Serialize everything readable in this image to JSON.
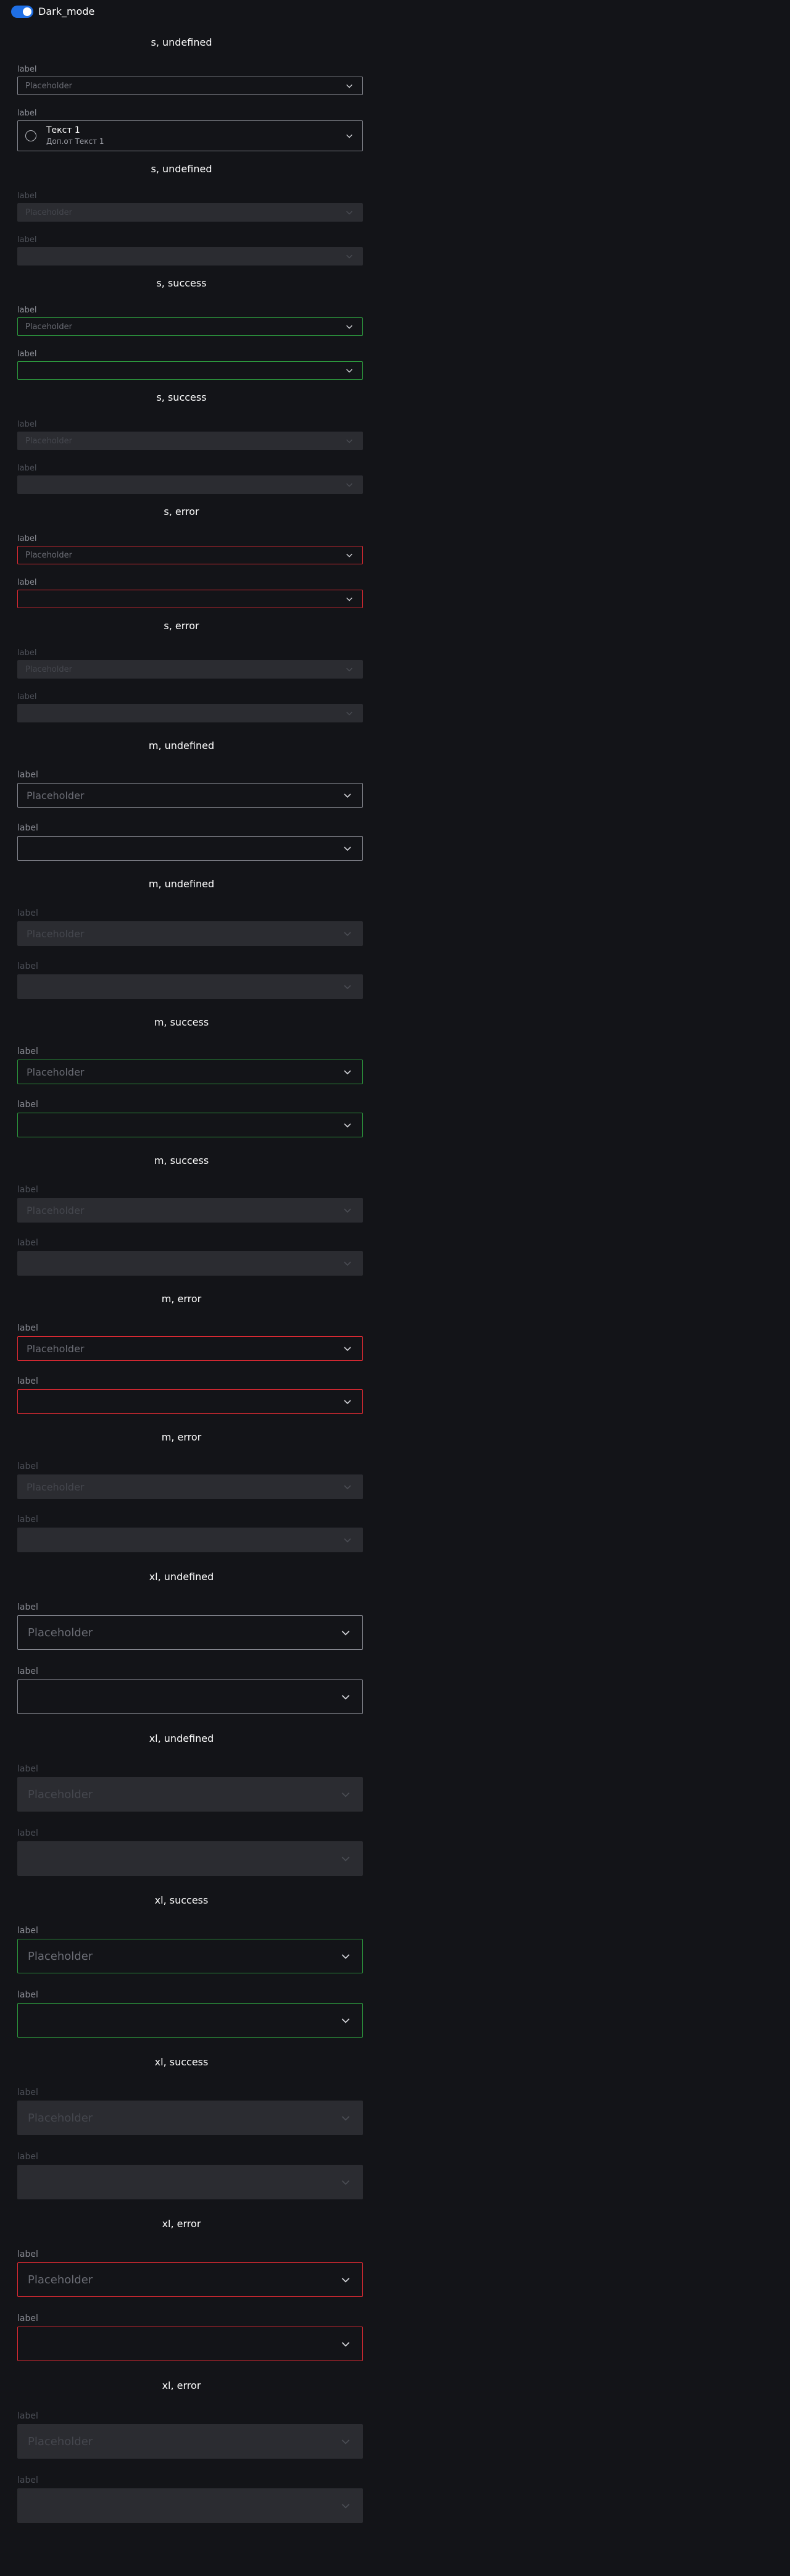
{
  "toggle": {
    "label": "Dark_mode",
    "on": true
  },
  "colors": {
    "accent": "#1f6fe5",
    "success": "#2d9a3e",
    "error": "#e02a33",
    "background": "#131418"
  },
  "sections": [
    {
      "title": "s, undefined",
      "size": "s",
      "status": "",
      "disabled": false,
      "fields": [
        {
          "label": "label",
          "placeholder": "Placeholder"
        },
        {
          "label": "label",
          "option": {
            "title": "Текст 1",
            "subtitle": "Доп.от Текст 1"
          }
        }
      ]
    },
    {
      "title": "s, undefined",
      "size": "s",
      "status": "",
      "disabled": true,
      "fields": [
        {
          "label": "label",
          "placeholder": "Placeholder"
        },
        {
          "label": "label",
          "placeholder": ""
        }
      ]
    },
    {
      "title": "s, success",
      "size": "s",
      "status": "success",
      "disabled": false,
      "fields": [
        {
          "label": "label",
          "placeholder": "Placeholder"
        },
        {
          "label": "label",
          "placeholder": ""
        }
      ]
    },
    {
      "title": "s, success",
      "size": "s",
      "status": "success",
      "disabled": true,
      "fields": [
        {
          "label": "label",
          "placeholder": "Placeholder"
        },
        {
          "label": "label",
          "placeholder": ""
        }
      ]
    },
    {
      "title": "s, error",
      "size": "s",
      "status": "error",
      "disabled": false,
      "fields": [
        {
          "label": "label",
          "placeholder": "Placeholder"
        },
        {
          "label": "label",
          "placeholder": ""
        }
      ]
    },
    {
      "title": "s, error",
      "size": "s",
      "status": "error",
      "disabled": true,
      "fields": [
        {
          "label": "label",
          "placeholder": "Placeholder"
        },
        {
          "label": "label",
          "placeholder": ""
        }
      ]
    },
    {
      "title": "m, undefined",
      "size": "m",
      "status": "",
      "disabled": false,
      "fields": [
        {
          "label": "label",
          "placeholder": "Placeholder"
        },
        {
          "label": "label",
          "placeholder": ""
        }
      ]
    },
    {
      "title": "m, undefined",
      "size": "m",
      "status": "",
      "disabled": true,
      "fields": [
        {
          "label": "label",
          "placeholder": "Placeholder"
        },
        {
          "label": "label",
          "placeholder": ""
        }
      ]
    },
    {
      "title": "m, success",
      "size": "m",
      "status": "success",
      "disabled": false,
      "fields": [
        {
          "label": "label",
          "placeholder": "Placeholder"
        },
        {
          "label": "label",
          "placeholder": ""
        }
      ]
    },
    {
      "title": "m, success",
      "size": "m",
      "status": "success",
      "disabled": true,
      "fields": [
        {
          "label": "label",
          "placeholder": "Placeholder"
        },
        {
          "label": "label",
          "placeholder": ""
        }
      ]
    },
    {
      "title": "m, error",
      "size": "m",
      "status": "error",
      "disabled": false,
      "fields": [
        {
          "label": "label",
          "placeholder": "Placeholder"
        },
        {
          "label": "label",
          "placeholder": ""
        }
      ]
    },
    {
      "title": "m, error",
      "size": "m",
      "status": "error",
      "disabled": true,
      "fields": [
        {
          "label": "label",
          "placeholder": "Placeholder"
        },
        {
          "label": "label",
          "placeholder": ""
        }
      ]
    },
    {
      "title": "xl, undefined",
      "size": "xl",
      "status": "",
      "disabled": false,
      "fields": [
        {
          "label": "label",
          "placeholder": "Placeholder"
        },
        {
          "label": "label",
          "placeholder": ""
        }
      ]
    },
    {
      "title": "xl, undefined",
      "size": "xl",
      "status": "",
      "disabled": true,
      "fields": [
        {
          "label": "label",
          "placeholder": "Placeholder"
        },
        {
          "label": "label",
          "placeholder": ""
        }
      ]
    },
    {
      "title": "xl, success",
      "size": "xl",
      "status": "success",
      "disabled": false,
      "fields": [
        {
          "label": "label",
          "placeholder": "Placeholder"
        },
        {
          "label": "label",
          "placeholder": ""
        }
      ]
    },
    {
      "title": "xl, success",
      "size": "xl",
      "status": "success",
      "disabled": true,
      "fields": [
        {
          "label": "label",
          "placeholder": "Placeholder"
        },
        {
          "label": "label",
          "placeholder": ""
        }
      ]
    },
    {
      "title": "xl, error",
      "size": "xl",
      "status": "error",
      "disabled": false,
      "fields": [
        {
          "label": "label",
          "placeholder": "Placeholder"
        },
        {
          "label": "label",
          "placeholder": ""
        }
      ]
    },
    {
      "title": "xl, error",
      "size": "xl",
      "status": "error",
      "disabled": true,
      "fields": [
        {
          "label": "label",
          "placeholder": "Placeholder"
        },
        {
          "label": "label",
          "placeholder": ""
        }
      ]
    }
  ]
}
